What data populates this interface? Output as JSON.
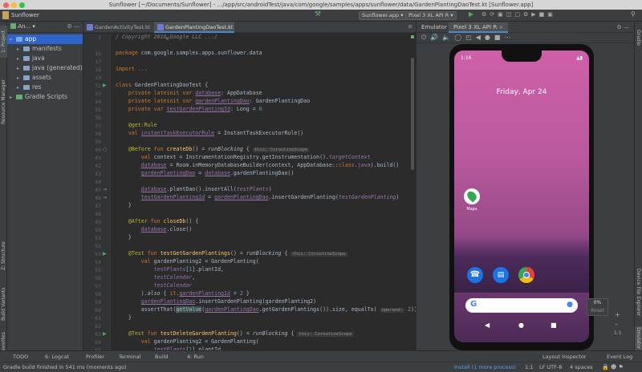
{
  "window": {
    "title": "Sunflower [~/Documents/Sunflower] - .../app/src/androidTest/java/com/google/samples/apps/sunflower/data/GardenPlantingDaoTest.kt [Sunflower.app]"
  },
  "toolbar": {
    "project": "Sunflower",
    "config": "Sunflower.app",
    "device": "Pixel 3 XL API R"
  },
  "left_strip": {
    "project": "1: Project",
    "resource_manager": "Resource Manager",
    "structure": "Z: Structure",
    "build_variants": "Build Variants",
    "favorites": "2: Favorites"
  },
  "project_panel": {
    "header": "An...",
    "tree": [
      {
        "label": "app",
        "level": 0,
        "open": true
      },
      {
        "label": "manifests",
        "level": 1
      },
      {
        "label": "java",
        "level": 1
      },
      {
        "label": "java (generated)",
        "level": 1
      },
      {
        "label": "assets",
        "level": 1
      },
      {
        "label": "res",
        "level": 1
      },
      {
        "label": "Gradle Scripts",
        "level": 0
      }
    ]
  },
  "editor": {
    "tabs": [
      "GardenActivityTest.kt",
      "GardenPlantingDaoTest.kt"
    ],
    "line_numbers": [
      "1",
      "16",
      "17",
      "18",
      "19",
      "32",
      "33",
      "34",
      "35",
      "36",
      "37",
      "38",
      "39",
      "40",
      "41",
      "42",
      "43",
      "44",
      "45",
      "46",
      "47",
      "48",
      "49",
      "50",
      "51",
      "52",
      "53",
      "54",
      "55",
      "56",
      "57",
      "58",
      "59",
      "60",
      "61",
      "62",
      "63",
      "64",
      "65",
      "66",
      "67",
      "68"
    ]
  },
  "emulator": {
    "tab": "Emulator",
    "device_tab": "Pixel 3 XL API R",
    "clock": "1:16",
    "date": "Friday, Apr 24",
    "app_label": "Maps",
    "zoom": "0%",
    "reset": "Reset",
    "ratio": "1:1"
  },
  "bottom_tabs": [
    "TODO",
    "6: Logcat",
    "Profiler",
    "Terminal",
    "Build",
    "4: Run"
  ],
  "bottom_right": [
    "Layout Inspector",
    "Event Log"
  ],
  "right_strip": {
    "gradle": "Gradle",
    "device_file": "Device File Explorer",
    "emulator": "Emulator"
  },
  "status": {
    "message": "Gradle build finished in 541 ms (moments ago)",
    "install": "Install (1 more process)",
    "position": "1:1",
    "encoding": "LF  UTF-8",
    "indent": "4 spaces"
  }
}
